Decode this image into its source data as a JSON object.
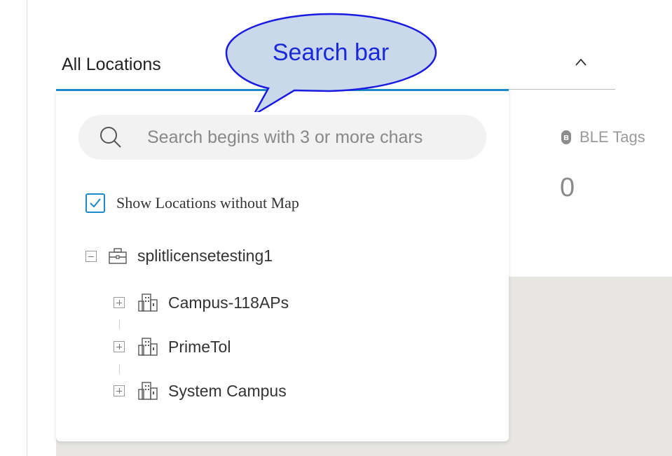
{
  "location_selector": {
    "title": "All Locations"
  },
  "search": {
    "placeholder": "Search begins with 3 or more chars",
    "value": ""
  },
  "filter": {
    "show_without_map_label": "Show Locations without Map",
    "show_without_map_checked": true
  },
  "tree": {
    "root": {
      "label": "splitlicensetesting1",
      "expanded": true,
      "icon": "briefcase-icon"
    },
    "children": [
      {
        "label": "Campus-118APs",
        "icon": "building-icon",
        "expanded": false
      },
      {
        "label": "PrimeTol",
        "icon": "building-icon",
        "expanded": false
      },
      {
        "label": "System Campus",
        "icon": "building-icon",
        "expanded": false
      }
    ]
  },
  "stats": {
    "ble_tags": {
      "label": "BLE Tags",
      "value": "0",
      "icon": "bluetooth-icon"
    }
  },
  "annotation": {
    "callout_text": "Search bar"
  },
  "colors": {
    "accent": "#1d8ccb",
    "callout_fill": "#c9d8ea",
    "callout_stroke": "#1a1ae0",
    "callout_text": "#1a2ad8"
  }
}
